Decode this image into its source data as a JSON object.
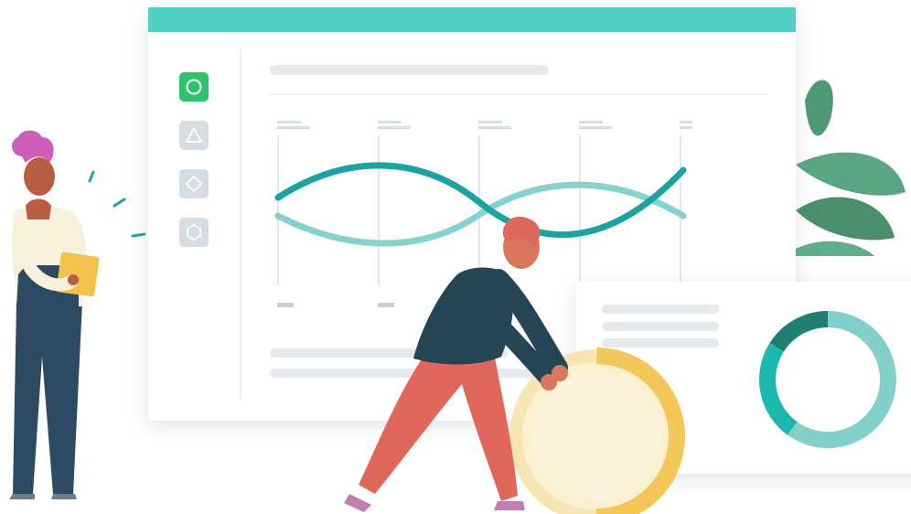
{
  "theme": {
    "header_color": "#52d0c4",
    "active_button_color": "#2ec36a",
    "inactive_button_color": "#d6dde3",
    "wave_dark": "#1aa3a1",
    "wave_light": "#86d2cf",
    "donut_colors": [
      "#83d0cb",
      "#1bb9ad",
      "#1f7f73"
    ],
    "coin_fill": "#fbf0cf",
    "coin_rim": "#f3c75a",
    "leaf_color": "#4f9a74"
  },
  "sidebar": {
    "items": [
      {
        "icon": "circle-icon",
        "active": true
      },
      {
        "icon": "triangle-icon",
        "active": false
      },
      {
        "icon": "diamond-icon",
        "active": false
      },
      {
        "icon": "hexagon-icon",
        "active": false
      }
    ]
  },
  "chart": {
    "x_ticks": 5
  },
  "donut_chart": {
    "segments": [
      0.6,
      0.24,
      0.16
    ]
  },
  "characters": [
    {
      "name": "woman-with-clipboard"
    },
    {
      "name": "man-pushing-coin"
    }
  ]
}
